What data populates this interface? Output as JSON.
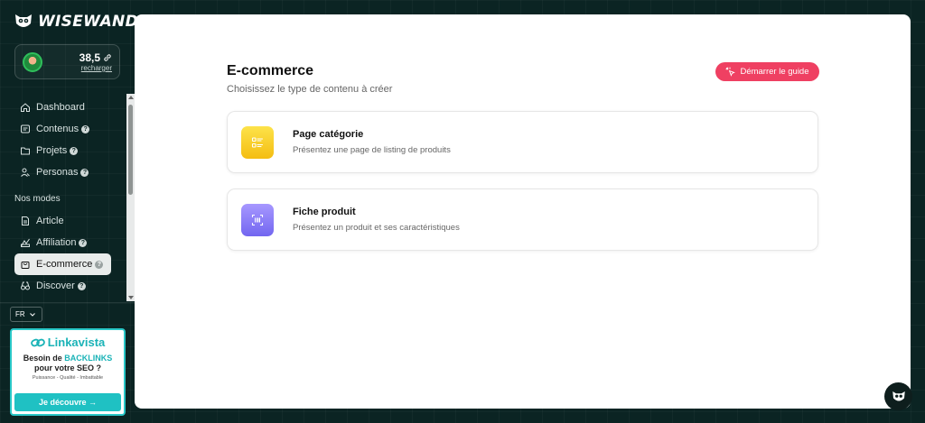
{
  "brand": {
    "name": "WISEWAND"
  },
  "account": {
    "credits": "38,5",
    "recharge_label": "recharger"
  },
  "nav": {
    "items": [
      {
        "label": "Dashboard",
        "icon": "home-icon",
        "help": false
      },
      {
        "label": "Contenus",
        "icon": "document-icon",
        "help": true
      },
      {
        "label": "Projets",
        "icon": "folder-icon",
        "help": true
      },
      {
        "label": "Personas",
        "icon": "users-icon",
        "help": true
      }
    ],
    "modes_label": "Nos modes",
    "modes": [
      {
        "label": "Article",
        "icon": "article-icon",
        "help": false
      },
      {
        "label": "Affiliation",
        "icon": "affiliation-icon",
        "help": true
      },
      {
        "label": "E-commerce",
        "icon": "shopping-bag-icon",
        "help": true,
        "active": true
      },
      {
        "label": "Discover",
        "icon": "binoculars-icon",
        "help": true
      }
    ],
    "help_glyph": "?"
  },
  "language": {
    "selected": "FR"
  },
  "promo": {
    "brand": "Linkavista",
    "title_prefix": "Besoin de",
    "title_highlight": "BACKLINKS",
    "title_suffix": "pour votre SEO ?",
    "subtitle": "Puissance - Qualité - Imbattable",
    "button": "Je découvre →"
  },
  "main": {
    "title": "E-commerce",
    "subtitle": "Choisissez le type de contenu à créer",
    "guide_button": "Démarrer le guide",
    "cards": [
      {
        "title": "Page catégorie",
        "description": "Présentez une page de listing de produits",
        "color": "#f6c21a"
      },
      {
        "title": "Fiche produit",
        "description": "Présentez un produit et ses caractéristiques",
        "color": "#7d70f5"
      }
    ]
  },
  "colors": {
    "accent": "#ef4062",
    "sidebar_bg": "#0b2423",
    "promo": "#1fc1c3"
  }
}
